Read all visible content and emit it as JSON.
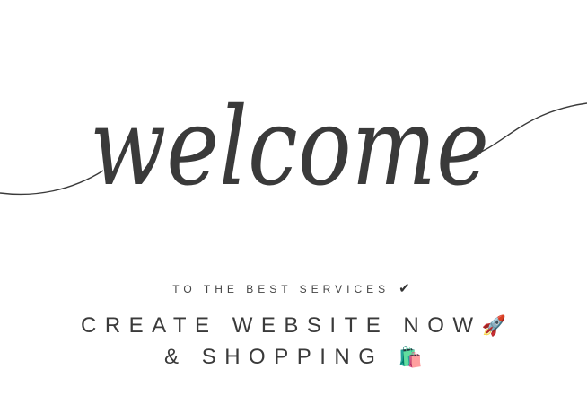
{
  "logo": {
    "text": "welcome"
  },
  "tagline": {
    "text": "TO THE BEST SERVICES",
    "icon": "checkmark-icon"
  },
  "headline": {
    "line1": "CREATE WEBSITE NOW",
    "line1_icon": "🚀",
    "line2": "& SHOPPING",
    "line2_icon": "🛍️"
  },
  "colors": {
    "text": "#3a3a3a",
    "background": "#ffffff"
  }
}
